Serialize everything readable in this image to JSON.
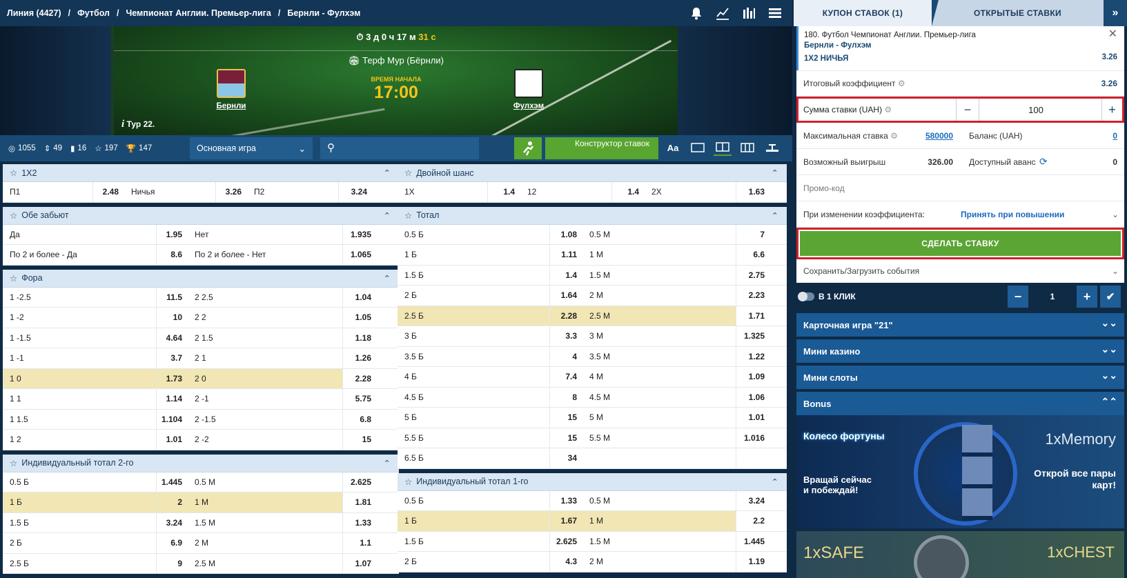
{
  "breadcrumb": [
    "Линия (4427)",
    "Футбол",
    "Чемпионат Англии. Премьер-лига",
    "Бернли - Фулхэм"
  ],
  "match": {
    "timer": {
      "d": "3",
      "d_unit": "д",
      "h": "0",
      "h_unit": "ч",
      "m": "17",
      "m_unit": "м",
      "s": "31",
      "s_unit": "с"
    },
    "stadium": "Терф Мур (Бёрнли)",
    "start_label": "ВРЕМЯ НАЧАЛА",
    "start_time": "17:00",
    "home": "Бернли",
    "away": "Фулхэм",
    "tour": "Тур 22."
  },
  "filters": {
    "counts": [
      "1055",
      "49",
      "16",
      "197",
      "147"
    ],
    "select": "Основная игра",
    "constructor": "Конструктор ставок"
  },
  "left_markets": [
    {
      "title": "1X2",
      "rows": [
        [
          "П1",
          "2.48",
          "Ничья",
          "3.26",
          "П2",
          "3.24"
        ]
      ]
    },
    {
      "title": "Обе забьют",
      "rows": [
        [
          "Да",
          "1.95",
          "Нет",
          "1.935"
        ],
        [
          "По 2 и более - Да",
          "8.6",
          "По 2 и более - Нет",
          "1.065"
        ]
      ]
    },
    {
      "title": "Фора",
      "rows": [
        [
          "1 -2.5",
          "11.5",
          "2 2.5",
          "1.04"
        ],
        [
          "1 -2",
          "10",
          "2 2",
          "1.05"
        ],
        [
          "1 -1.5",
          "4.64",
          "2 1.5",
          "1.18"
        ],
        [
          "1 -1",
          "3.7",
          "2 1",
          "1.26"
        ],
        [
          "1 0",
          "1.73",
          "2 0",
          "2.28"
        ],
        [
          "1 1",
          "1.14",
          "2 -1",
          "5.75"
        ],
        [
          "1 1.5",
          "1.104",
          "2 -1.5",
          "6.8"
        ],
        [
          "1 2",
          "1.01",
          "2 -2",
          "15"
        ]
      ]
    },
    {
      "title": "Индивидуальный тотал 2-го",
      "rows": [
        [
          "0.5 Б",
          "1.445",
          "0.5 М",
          "2.625"
        ],
        [
          "1 Б",
          "2",
          "1 М",
          "1.81"
        ],
        [
          "1.5 Б",
          "3.24",
          "1.5 М",
          "1.33"
        ],
        [
          "2 Б",
          "6.9",
          "2 М",
          "1.1"
        ],
        [
          "2.5 Б",
          "9",
          "2.5 М",
          "1.07"
        ]
      ]
    }
  ],
  "right_markets": [
    {
      "title": "Двойной шанс",
      "rows": [
        [
          "1X",
          "1.4",
          "12",
          "1.4",
          "2X",
          "1.63"
        ]
      ]
    },
    {
      "title": "Тотал",
      "rows": [
        [
          "0.5 Б",
          "1.08",
          "0.5 М",
          "7"
        ],
        [
          "1 Б",
          "1.11",
          "1 М",
          "6.6"
        ],
        [
          "1.5 Б",
          "1.4",
          "1.5 М",
          "2.75"
        ],
        [
          "2 Б",
          "1.64",
          "2 М",
          "2.23"
        ],
        [
          "2.5 Б",
          "2.28",
          "2.5 М",
          "1.71"
        ],
        [
          "3 Б",
          "3.3",
          "3 М",
          "1.325"
        ],
        [
          "3.5 Б",
          "4",
          "3.5 М",
          "1.22"
        ],
        [
          "4 Б",
          "7.4",
          "4 М",
          "1.09"
        ],
        [
          "4.5 Б",
          "8",
          "4.5 М",
          "1.06"
        ],
        [
          "5 Б",
          "15",
          "5 М",
          "1.01"
        ],
        [
          "5.5 Б",
          "15",
          "5.5 М",
          "1.016"
        ],
        [
          "6.5 Б",
          "34",
          "",
          ""
        ]
      ]
    },
    {
      "title": "Индивидуальный тотал 1-го",
      "rows": [
        [
          "0.5 Б",
          "1.33",
          "0.5 М",
          "3.24"
        ],
        [
          "1 Б",
          "1.67",
          "1 М",
          "2.2"
        ],
        [
          "1.5 Б",
          "2.625",
          "1.5 М",
          "1.445"
        ],
        [
          "2 Б",
          "4.3",
          "2 М",
          "1.19"
        ]
      ]
    }
  ],
  "coupon": {
    "tab_active": "КУПОН СТАВОК (1)",
    "tab_other": "ОТКРЫТЫЕ СТАВКИ",
    "event_line": "180. Футбол Чемпионат Англии. Премьер-лига",
    "event_teams": "Бернли - Фулхэм",
    "event_outcome": "1X2 НИЧЬЯ",
    "event_odd": "3.26",
    "total_label": "Итоговый коэффициент",
    "total_value": "3.26",
    "stake_label": "Сумма ставки (UAH)",
    "stake_value": "100",
    "max_label": "Максимальная ставка",
    "max_value": "580000",
    "balance_label": "Баланс (UAH)",
    "balance_value": "0",
    "win_label": "Возможный выигрыш",
    "win_value": "326.00",
    "avans_label": "Доступный аванс",
    "avans_value": "0",
    "promo_label": "Промо-код",
    "change_label": "При изменении коэффициента:",
    "change_value": "Принять при повышении",
    "place_label": "СДЕЛАТЬ СТАВКУ",
    "save_label": "Сохранить/Загрузить события",
    "oneclick_label": "В 1 КЛИК",
    "oneclick_value": "1"
  },
  "side": {
    "acc1": "Карточная игра \"21\"",
    "acc2": "Мини казино",
    "acc3": "Мини слоты",
    "acc4": "Bonus",
    "promo_left_title": "Колесо фортуны",
    "promo_left_sub": "Вращай сейчас и побеждай!",
    "promo_right_title": "1xMemory",
    "promo_right_sub": "Открой все пары карт!",
    "safe": "1xSAFE",
    "chest": "1xCHEST"
  }
}
